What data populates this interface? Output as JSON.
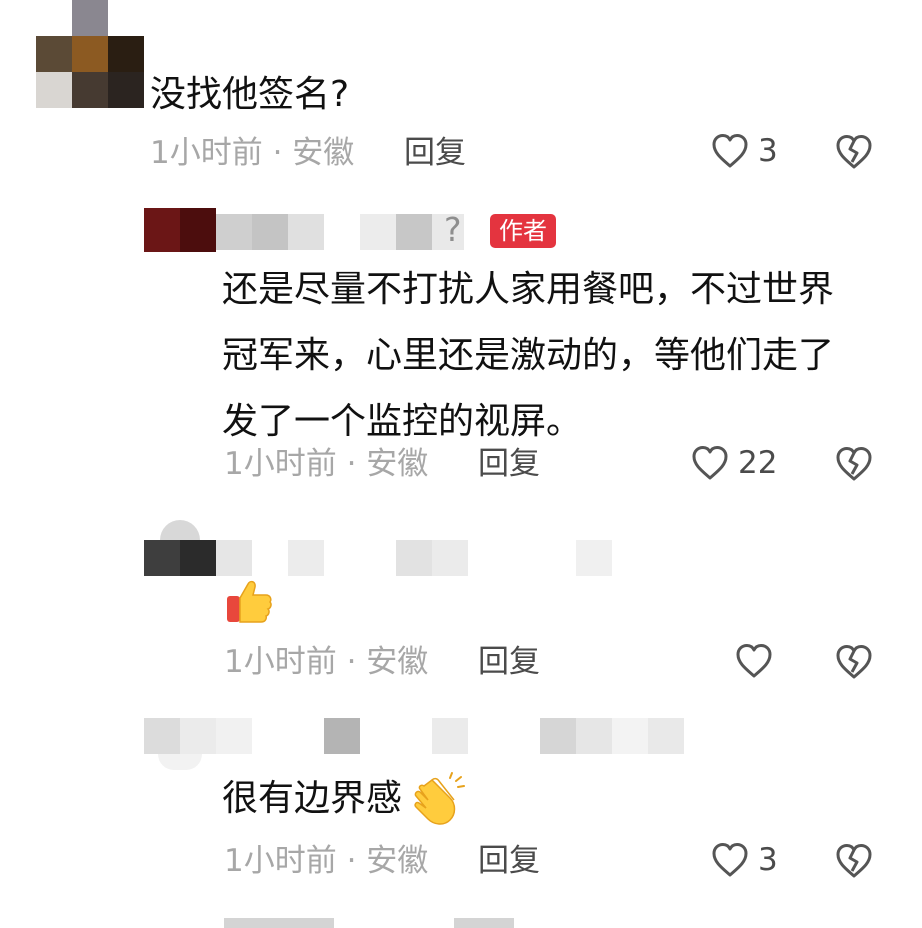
{
  "comments": [
    {
      "text": "没找他签名?",
      "meta": "1小时前 · 安徽",
      "reply_label": "回复",
      "like_count": "3"
    },
    {
      "name_suffix": "?",
      "author_badge": "作者",
      "text": "还是尽量不打扰人家用餐吧，不过世界\n冠军来，心里还是激动的，等他们走了\n发了一个监控的视屏。",
      "meta": "1小时前 · 安徽",
      "reply_label": "回复",
      "like_count": "22"
    },
    {
      "emoji": "thumbs-up-emoji",
      "meta": "1小时前 · 安徽",
      "reply_label": "回复",
      "like_count": ""
    },
    {
      "text": "很有边界感",
      "emoji": "clapping-hands-emoji",
      "meta": "1小时前 · 安徽",
      "reply_label": "回复",
      "like_count": "3"
    }
  ],
  "colors": {
    "meta": "#a7a7a7",
    "badge": "#e4343f",
    "text": "#111111"
  }
}
